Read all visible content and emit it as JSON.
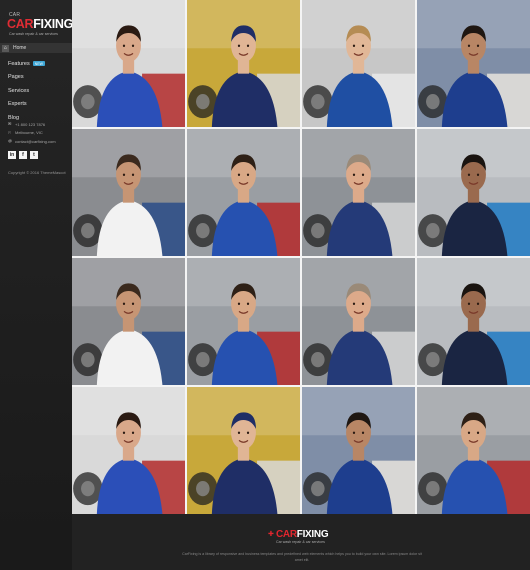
{
  "brand": {
    "logo_prefix": "CAR",
    "logo_suffix": "FIXING",
    "tagline": "Car wash repair & car services",
    "car_label": "CAR"
  },
  "sidebar": {
    "home_label": "Home",
    "items": [
      {
        "label": "Features",
        "badge": "NEW"
      },
      {
        "label": "Pages",
        "badge": ""
      },
      {
        "label": "Services",
        "badge": ""
      },
      {
        "label": "Experts",
        "badge": ""
      },
      {
        "label": "Blog",
        "badge": ""
      }
    ],
    "contact": [
      {
        "icon": "✉",
        "text": "+1 800 123 7876"
      },
      {
        "icon": "⚐",
        "text": "Melbourne, VIC"
      },
      {
        "icon": "@",
        "text": "contact@carfixing.com"
      }
    ],
    "social": [
      "in",
      "f",
      "t"
    ],
    "copyright": "Copyright © 2016 ThemeMascot"
  },
  "footer": {
    "logo_prefix": "CAR",
    "logo_suffix": "FIXING",
    "tagline": "Car wash repair & car services",
    "text": "CarFixing is a library of responsive and business templates and predefined web elements which helps you to build your own site. Lorem ipsum dolor sit amet elit."
  },
  "gallery": {
    "tiles": [
      {
        "name": "mechanic-woman-tire",
        "bg": "#d9d9d9",
        "shirt": "#2b4fb8",
        "skin": "#d9a88a",
        "hair": "#2a1a12",
        "accent": "#b22a2a"
      },
      {
        "name": "mechanic-woman-cap",
        "bg": "#c8a83a",
        "shirt": "#1f2e66",
        "skin": "#e0b595",
        "hair": "#1f2e66",
        "accent": "#d8d8d8"
      },
      {
        "name": "mechanic-tablet-car",
        "bg": "#c7c7c7",
        "shirt": "#1f4fa3",
        "skin": "#e1b797",
        "hair": "#b58c54",
        "accent": "#e9e9e9"
      },
      {
        "name": "mechanic-clipboard",
        "bg": "#7f8ea7",
        "shirt": "#1e3e8e",
        "skin": "#b88665",
        "hair": "#1f1712",
        "accent": "#e8e4dd"
      },
      {
        "name": "mechanic-laptop-wheel",
        "bg": "#8a8c90",
        "shirt": "#f2f2f2",
        "skin": "#c69574",
        "hair": "#3b2a1e",
        "accent": "#2a4c88"
      },
      {
        "name": "mechanic-alignment",
        "bg": "#9a9ea3",
        "shirt": "#2651b0",
        "skin": "#d8a886",
        "hair": "#2e2016",
        "accent": "#b4282a"
      },
      {
        "name": "mechanic-keys-grey",
        "bg": "#8e9297",
        "shirt": "#243a78",
        "skin": "#ddaa8a",
        "hair": "#9a8a78",
        "accent": "#d6d6d6"
      },
      {
        "name": "mechanic-tire-kneel",
        "bg": "#b9bcc0",
        "shirt": "#1a2542",
        "skin": "#9a6a4e",
        "hair": "#1a1410",
        "accent": "#1f7ac3"
      },
      {
        "name": "mechanic-laptop-wheel-2",
        "bg": "#8a8c90",
        "shirt": "#f2f2f2",
        "skin": "#c69574",
        "hair": "#3b2a1e",
        "accent": "#2a4c88"
      },
      {
        "name": "mechanic-alignment-2",
        "bg": "#9a9ea3",
        "shirt": "#2651b0",
        "skin": "#d8a886",
        "hair": "#2e2016",
        "accent": "#b4282a"
      },
      {
        "name": "mechanic-keys-grey-2",
        "bg": "#8e9297",
        "shirt": "#243a78",
        "skin": "#ddaa8a",
        "hair": "#9a8a78",
        "accent": "#d6d6d6"
      },
      {
        "name": "mechanic-tire-kneel-2",
        "bg": "#b9bcc0",
        "shirt": "#1a2542",
        "skin": "#9a6a4e",
        "hair": "#1a1410",
        "accent": "#1f7ac3"
      },
      {
        "name": "mechanic-woman-tire-2",
        "bg": "#d9d9d9",
        "shirt": "#2b4fb8",
        "skin": "#d9a88a",
        "hair": "#2a1a12",
        "accent": "#b22a2a"
      },
      {
        "name": "mechanic-woman-cap-2",
        "bg": "#c8a83a",
        "shirt": "#1f2e66",
        "skin": "#e0b595",
        "hair": "#1f2e66",
        "accent": "#d8d8d8"
      },
      {
        "name": "mechanic-clipboard-2",
        "bg": "#7f8ea7",
        "shirt": "#1e3e8e",
        "skin": "#b88665",
        "hair": "#1f1712",
        "accent": "#e8e4dd"
      },
      {
        "name": "mechanic-alignment-3",
        "bg": "#9a9ea3",
        "shirt": "#2651b0",
        "skin": "#d8a886",
        "hair": "#2e2016",
        "accent": "#b4282a"
      }
    ]
  }
}
